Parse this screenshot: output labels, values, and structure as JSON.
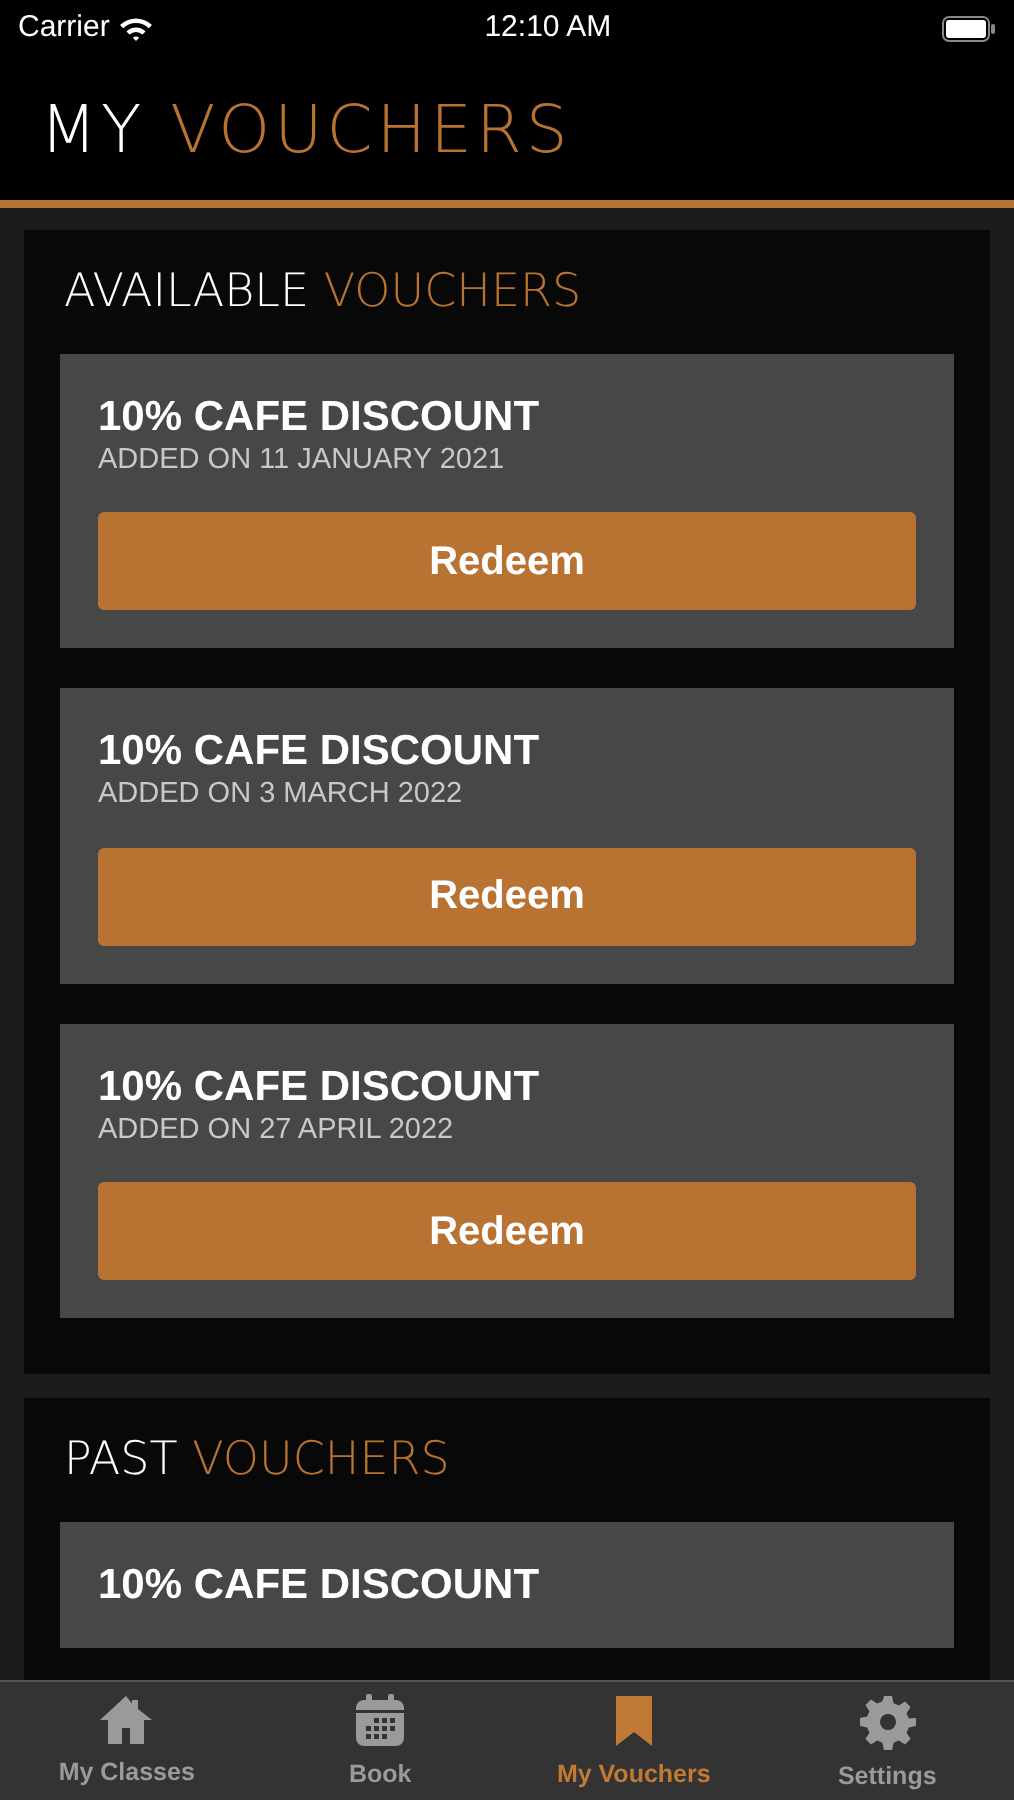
{
  "status_bar": {
    "carrier": "Carrier",
    "time": "12:10 AM"
  },
  "header": {
    "title": [
      {
        "text": "MY",
        "accent": false
      },
      {
        "text": "VOUCHERS",
        "accent": true
      }
    ]
  },
  "sections": [
    {
      "heading": [
        {
          "text": "AVAILABLE",
          "accent": false
        },
        {
          "text": "VOUCHERS",
          "accent": true
        }
      ],
      "vouchers": [
        {
          "title": "10% CAFE DISCOUNT",
          "date": "ADDED ON 11 JANUARY 2021",
          "button": "Redeem"
        },
        {
          "title": "10% CAFE DISCOUNT",
          "date": "ADDED ON 3 MARCH 2022",
          "button": "Redeem"
        },
        {
          "title": "10% CAFE DISCOUNT",
          "date": "ADDED ON 27 APRIL 2022",
          "button": "Redeem"
        }
      ]
    },
    {
      "heading": [
        {
          "text": "PAST",
          "accent": false
        },
        {
          "text": "VOUCHERS",
          "accent": true
        }
      ],
      "vouchers": [
        {
          "title": "10% CAFE DISCOUNT"
        }
      ]
    }
  ],
  "tab_bar": [
    {
      "kind": "home",
      "label": "My Classes",
      "selected": false
    },
    {
      "kind": "calendar",
      "label": "Book",
      "selected": false
    },
    {
      "kind": "bookmark",
      "label": "My Vouchers",
      "selected": true
    },
    {
      "kind": "gear",
      "label": "Settings",
      "selected": false
    }
  ]
}
